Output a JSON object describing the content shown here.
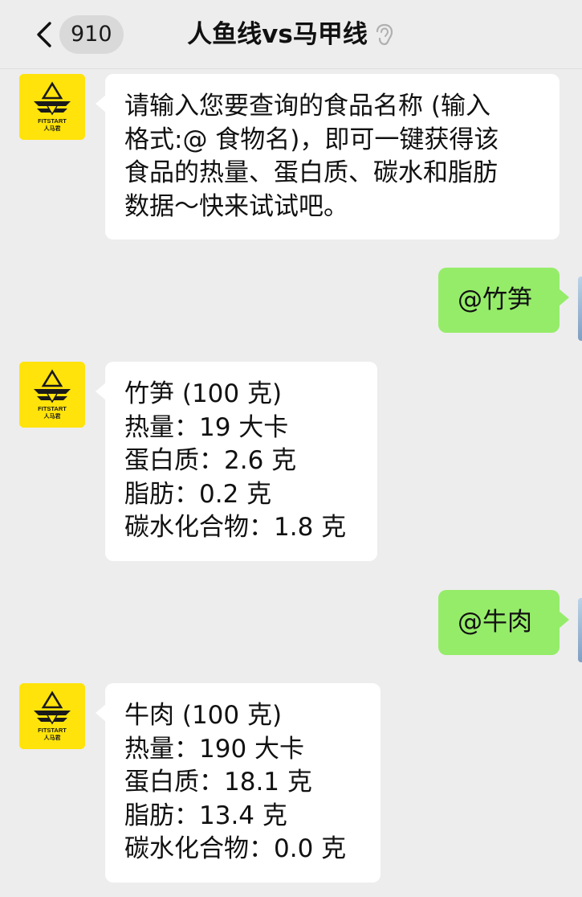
{
  "header": {
    "unread_count": "910",
    "title": "人鱼线vs马甲线",
    "ear_icon": "ear-icon"
  },
  "avatar": {
    "brand_text": "FITSTART",
    "brand_sub": "人马君",
    "color": "#ffe30a"
  },
  "messages": [
    {
      "side": "in",
      "text": "请输入您要查询的食品名称 (输入\n格式:@ 食物名)，即可一键获得该\n食品的热量、蛋白质、碳水和脂肪\n数据～快来试试吧。"
    },
    {
      "side": "out",
      "text": "@竹笋"
    },
    {
      "side": "in",
      "text": "竹笋 (100 克)\n热量：19 大卡\n蛋白质：2.6 克\n脂肪：0.2 克\n碳水化合物：1.8 克"
    },
    {
      "side": "out",
      "text": "@牛肉"
    },
    {
      "side": "in",
      "text": "牛肉 (100 克)\n热量：190 大卡\n蛋白质：18.1 克\n脂肪：13.4 克\n碳水化合物：0.0 克"
    }
  ],
  "colors": {
    "background": "#ededed",
    "incoming_bubble": "#ffffff",
    "outgoing_bubble": "#95ec69"
  }
}
